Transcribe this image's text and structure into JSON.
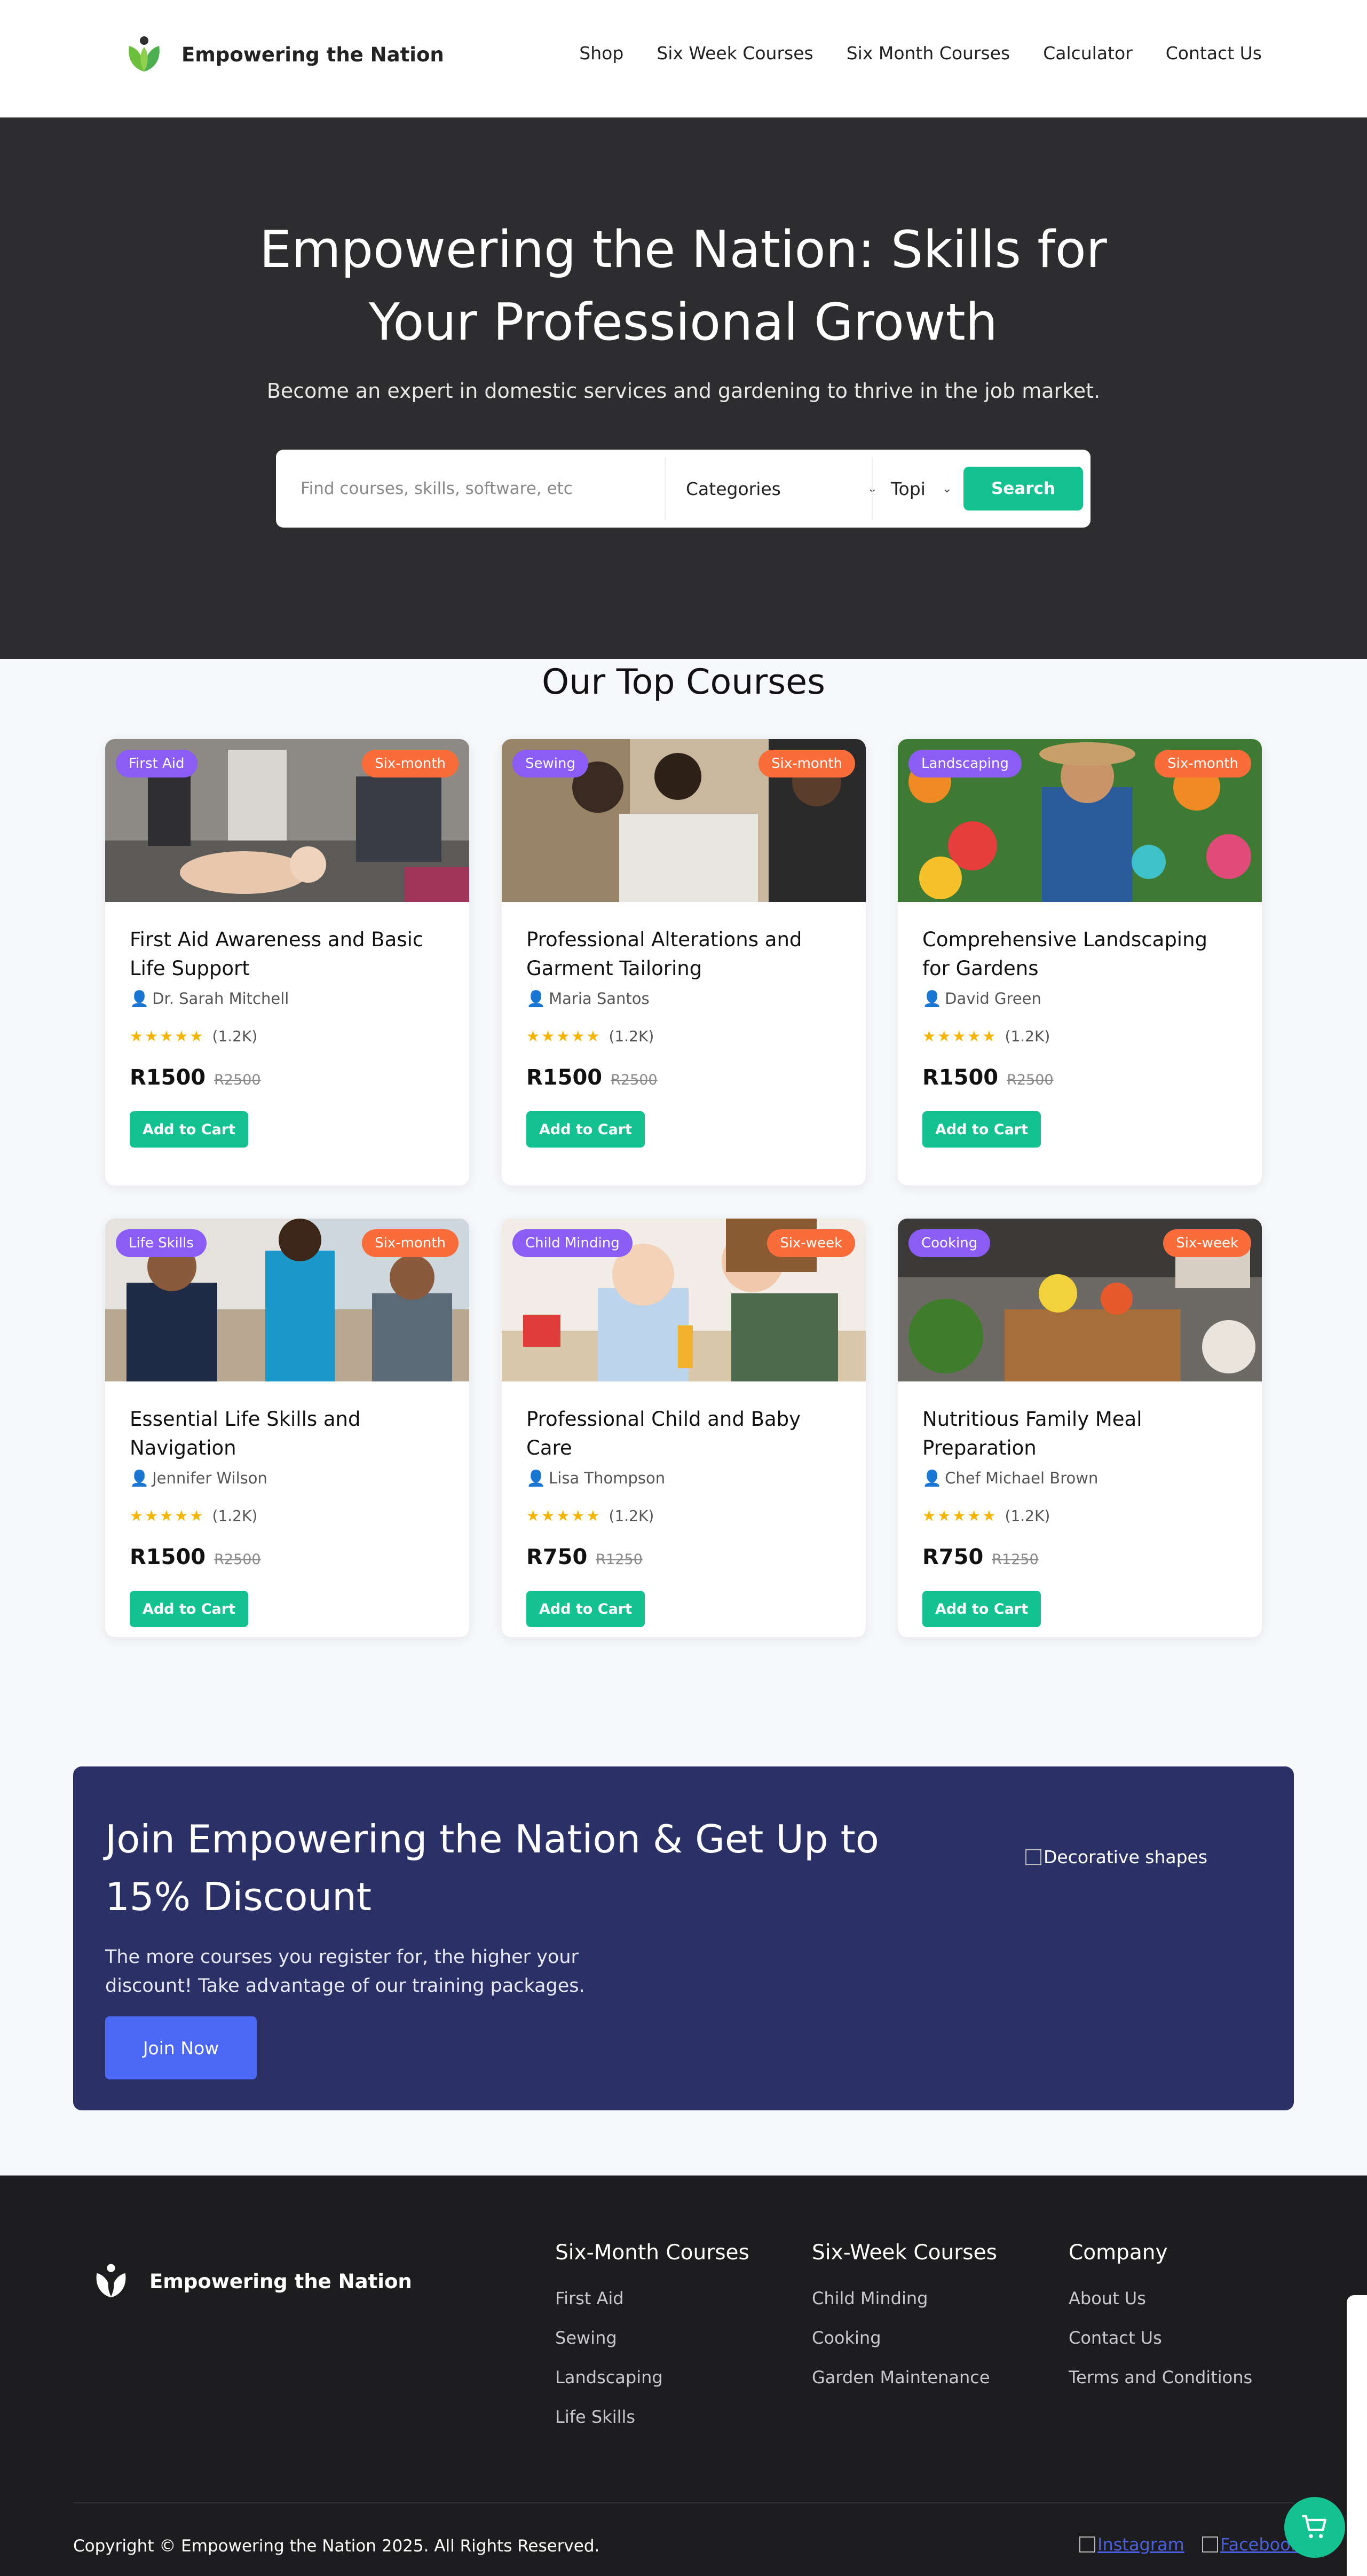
{
  "nav": {
    "brand": "Empowering the Nation",
    "links": [
      "Shop",
      "Six Week Courses",
      "Six Month Courses",
      "Calculator",
      "Contact Us"
    ]
  },
  "hero": {
    "title": "Empowering the Nation: Skills for Your Professional Growth",
    "subtitle": "Become an expert in domestic services and gardening to thrive in the job market.",
    "search_placeholder": "Find courses, skills, software, etc",
    "category_select": "Categories",
    "topic_select": "Topi",
    "search_button": "Search"
  },
  "courses_section": {
    "title": "Our Top Courses",
    "add_to_cart_label": "Add to Cart",
    "instructor_icon": "user-icon",
    "stars": "★★★★★",
    "courses": [
      {
        "category": "First Aid",
        "duration": "Six-month",
        "title": "First Aid Awareness and Basic Life Support",
        "instructor": "Dr. Sarah Mitchell",
        "reviews": "(1.2K)",
        "price": "R1500",
        "old_price": "R2500"
      },
      {
        "category": "Sewing",
        "duration": "Six-month",
        "title": "Professional Alterations and Garment Tailoring",
        "instructor": "Maria Santos",
        "reviews": "(1.2K)",
        "price": "R1500",
        "old_price": "R2500"
      },
      {
        "category": "Landscaping",
        "duration": "Six-month",
        "title": "Comprehensive Landscaping for Gardens",
        "instructor": "David Green",
        "reviews": "(1.2K)",
        "price": "R1500",
        "old_price": "R2500"
      },
      {
        "category": "Life Skills",
        "duration": "Six-month",
        "title": "Essential Life Skills and Navigation",
        "instructor": "Jennifer Wilson",
        "reviews": "(1.2K)",
        "price": "R1500",
        "old_price": "R2500"
      },
      {
        "category": "Child Minding",
        "duration": "Six-week",
        "title": "Professional Child and Baby Care",
        "instructor": "Lisa Thompson",
        "reviews": "(1.2K)",
        "price": "R750",
        "old_price": "R1250"
      },
      {
        "category": "Cooking",
        "duration": "Six-week",
        "title": "Nutritious Family Meal Preparation",
        "instructor": "Chef Michael Brown",
        "reviews": "(1.2K)",
        "price": "R750",
        "old_price": "R1250"
      }
    ]
  },
  "promo": {
    "title": "Join Empowering the Nation & Get Up to 15% Discount",
    "text": "The more courses you register for, the higher your discount! Take advantage of our training packages.",
    "button": "Join Now",
    "image_alt": "Decorative shapes"
  },
  "footer": {
    "brand": "Empowering the Nation",
    "columns": [
      {
        "heading": "Six-Month Courses",
        "links": [
          "First Aid",
          "Sewing",
          "Landscaping",
          "Life Skills"
        ]
      },
      {
        "heading": "Six-Week Courses",
        "links": [
          "Child Minding",
          "Cooking",
          "Garden Maintenance"
        ]
      },
      {
        "heading": "Company",
        "links": [
          "About Us",
          "Contact Us",
          "Terms and Conditions"
        ]
      }
    ],
    "copyright": "Copyright © Empowering the Nation 2025. All Rights Reserved.",
    "social": [
      "Instagram",
      "Facebook"
    ]
  },
  "colors": {
    "accent_green": "#14c291",
    "hero_bg": "#2d2d2f",
    "promo_bg": "#2b3166",
    "promo_button": "#4a67f5",
    "category_badge": "#8b5cf6",
    "duration_badge": "#fa6c3a",
    "footer_bg": "#1d1d20"
  }
}
